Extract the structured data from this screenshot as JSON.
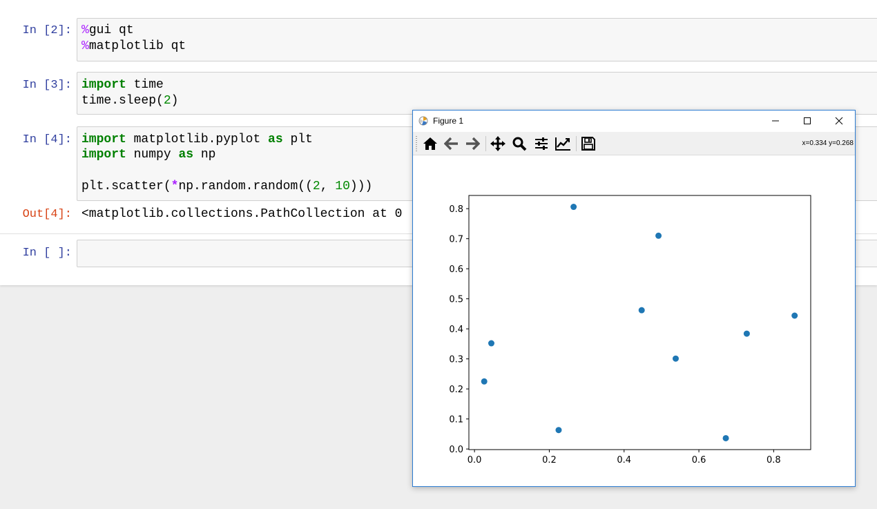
{
  "cells": [
    {
      "prompt": "In [2]:",
      "lines": [
        [
          {
            "t": "%",
            "c": "mg"
          },
          {
            "t": "gui qt",
            "c": ""
          }
        ],
        [
          {
            "t": "%",
            "c": "mg"
          },
          {
            "t": "matplotlib qt",
            "c": ""
          }
        ]
      ]
    },
    {
      "prompt": "In [3]:",
      "lines": [
        [
          {
            "t": "import",
            "c": "kw"
          },
          {
            "t": " time",
            "c": ""
          }
        ],
        [
          {
            "t": "time.sleep(",
            "c": ""
          },
          {
            "t": "2",
            "c": "nm"
          },
          {
            "t": ")",
            "c": ""
          }
        ]
      ]
    },
    {
      "prompt": "In [4]:",
      "lines": [
        [
          {
            "t": "import",
            "c": "kw"
          },
          {
            "t": " matplotlib.pyplot ",
            "c": ""
          },
          {
            "t": "as",
            "c": "kw"
          },
          {
            "t": " plt",
            "c": ""
          }
        ],
        [
          {
            "t": "import",
            "c": "kw"
          },
          {
            "t": " numpy ",
            "c": ""
          },
          {
            "t": "as",
            "c": "kw"
          },
          {
            "t": " np",
            "c": ""
          }
        ],
        [],
        [
          {
            "t": "plt.scatter(",
            "c": ""
          },
          {
            "t": "*",
            "c": "op"
          },
          {
            "t": "np.random.random((",
            "c": ""
          },
          {
            "t": "2",
            "c": "nm"
          },
          {
            "t": ", ",
            "c": ""
          },
          {
            "t": "10",
            "c": "nm"
          },
          {
            "t": ")))",
            "c": ""
          }
        ]
      ]
    },
    {
      "prompt": "In [ ]:",
      "lines": []
    }
  ],
  "output": {
    "prompt": "Out[4]:",
    "text": "<matplotlib.collections.PathCollection at 0"
  },
  "figure_window": {
    "title": "Figure 1",
    "coords": "x=0.334 y=0.268",
    "toolbar": [
      "home-icon",
      "back-icon",
      "forward-icon",
      "pan-icon",
      "zoom-icon",
      "subplots-icon",
      "edit-axis-icon",
      "save-icon"
    ]
  },
  "chart_data": {
    "type": "scatter",
    "x": [
      0.026,
      0.045,
      0.225,
      0.265,
      0.447,
      0.492,
      0.538,
      0.672,
      0.728,
      0.856
    ],
    "y": [
      0.225,
      0.352,
      0.063,
      0.806,
      0.462,
      0.71,
      0.301,
      0.036,
      0.384,
      0.444
    ],
    "xlim": [
      -0.015,
      0.899
    ],
    "ylim": [
      -0.002,
      0.844
    ],
    "xticks": [
      0.0,
      0.2,
      0.4,
      0.6,
      0.8
    ],
    "yticks": [
      0.0,
      0.1,
      0.2,
      0.3,
      0.4,
      0.5,
      0.6,
      0.7,
      0.8
    ],
    "xtick_labels": [
      "0.0",
      "0.2",
      "0.4",
      "0.6",
      "0.8"
    ],
    "ytick_labels": [
      "0.0",
      "0.1",
      "0.2",
      "0.3",
      "0.4",
      "0.5",
      "0.6",
      "0.7",
      "0.8"
    ],
    "color": "#1f77b4",
    "grid": false
  }
}
